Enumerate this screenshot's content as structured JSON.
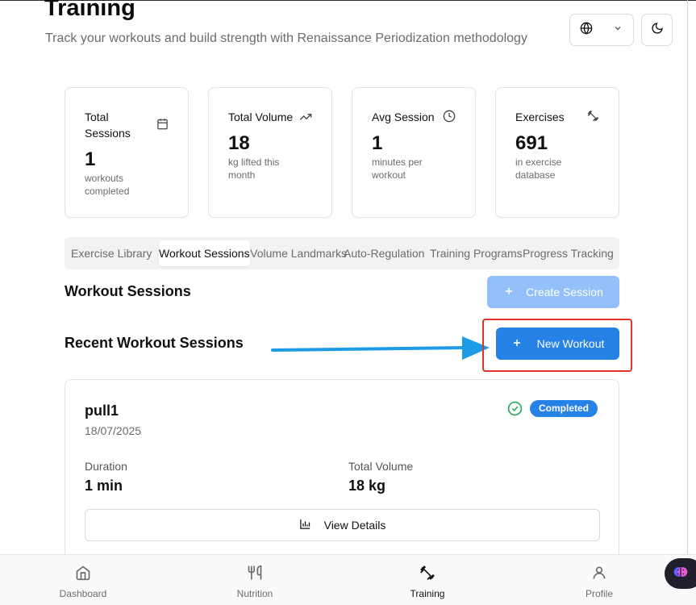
{
  "header": {
    "title": "Training",
    "subtitle": "Track your workouts and build strength with Renaissance Periodization methodology",
    "language_icon": "globe-icon",
    "theme_icon": "moon-icon"
  },
  "stats": [
    {
      "label": "Total Sessions",
      "value": "1",
      "desc": "workouts completed",
      "icon": "calendar-icon"
    },
    {
      "label": "Total Volume",
      "value": "18",
      "desc": "kg lifted this month",
      "icon": "trending-up-icon"
    },
    {
      "label": "Avg Session",
      "value": "1",
      "desc": "minutes per workout",
      "icon": "clock-icon"
    },
    {
      "label": "Exercises",
      "value": "691",
      "desc": "in exercise database",
      "icon": "dumbbell-icon"
    }
  ],
  "tabs": [
    {
      "label": "Exercise Library",
      "active": false
    },
    {
      "label": "Workout Sessions",
      "active": true
    },
    {
      "label": "Volume Landmarks",
      "active": false
    },
    {
      "label": "Auto-Regulation",
      "active": false
    },
    {
      "label": "Training Programs",
      "active": false
    },
    {
      "label": "Progress Tracking",
      "active": false
    }
  ],
  "sessions_section": {
    "title": "Workout Sessions",
    "create_label": "Create Session",
    "recent_title": "Recent Workout Sessions",
    "new_workout_label": "New Workout"
  },
  "session_card": {
    "name": "pull1",
    "date": "18/07/2025",
    "status": "Completed",
    "duration_label": "Duration",
    "duration_value": "1 min",
    "volume_label": "Total Volume",
    "volume_value": "18 kg",
    "details_label": "View Details"
  },
  "bottom_nav": [
    {
      "label": "Dashboard",
      "icon": "home-icon",
      "active": false
    },
    {
      "label": "Nutrition",
      "icon": "utensils-icon",
      "active": false
    },
    {
      "label": "Training",
      "icon": "dumbbell-icon",
      "active": true
    },
    {
      "label": "Profile",
      "icon": "user-icon",
      "active": false
    }
  ],
  "colors": {
    "primary": "#2682e6",
    "primary_disabled": "#93c0f8",
    "success": "#22a55a",
    "highlight": "#e0332b",
    "annotation_arrow": "#1e9be6"
  }
}
